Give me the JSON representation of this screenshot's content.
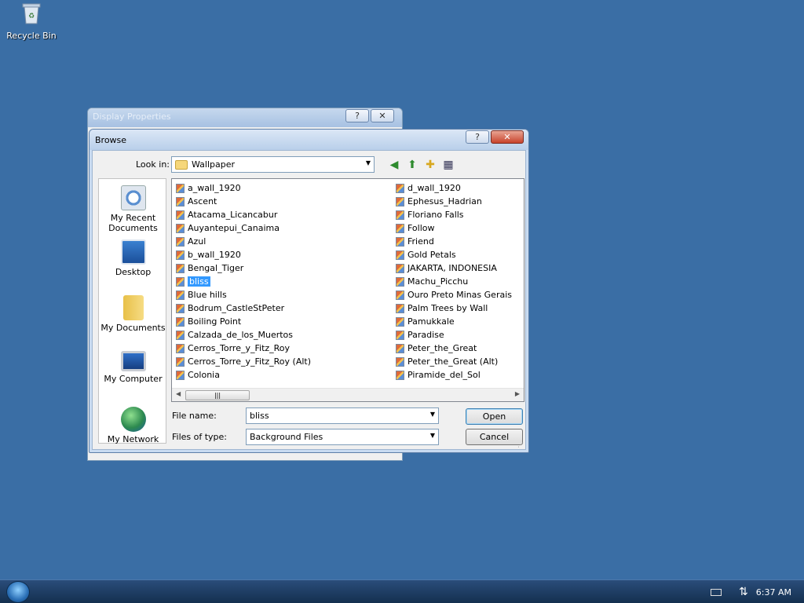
{
  "desktop": {
    "recycle_bin_label": "Recycle Bin"
  },
  "background_window": {
    "title": "Display Properties",
    "help_btn": "?",
    "close_btn": "✕"
  },
  "dialog": {
    "title": "Browse",
    "help_btn": "?",
    "close_btn": "✕",
    "look_in_label": "Look in:",
    "look_in_value": "Wallpaper",
    "places": [
      {
        "label": "My Recent Documents"
      },
      {
        "label": "Desktop"
      },
      {
        "label": "My Documents"
      },
      {
        "label": "My Computer"
      },
      {
        "label": "My Network"
      }
    ],
    "files_col1": [
      "a_wall_1920",
      "Ascent",
      "Atacama_Licancabur",
      "Auyantepui_Canaima",
      "Azul",
      "b_wall_1920",
      "Bengal_Tiger",
      "bliss",
      "Blue hills",
      "Bodrum_CastleStPeter",
      "Boiling Point",
      "Calzada_de_los_Muertos",
      "Cerros_Torre_y_Fitz_Roy",
      "Cerros_Torre_y_Fitz_Roy (Alt)",
      "Colonia"
    ],
    "files_col2": [
      "d_wall_1920",
      "Ephesus_Hadrian",
      "Floriano Falls",
      "Follow",
      "Friend",
      "Gold Petals",
      "JAKARTA, INDONESIA",
      "Machu_Picchu",
      "Ouro Preto Minas Gerais",
      "Palm Trees by Wall",
      "Pamukkale",
      "Paradise",
      "Peter_the_Great",
      "Peter_the_Great (Alt)",
      "Piramide_del_Sol"
    ],
    "selected_file": "bliss",
    "file_name_label": "File name:",
    "file_name_value": "bliss",
    "file_type_label": "Files of type:",
    "file_type_value": "Background Files",
    "open_label": "Open",
    "cancel_label": "Cancel"
  },
  "taskbar": {
    "clock": "6:37 AM"
  }
}
